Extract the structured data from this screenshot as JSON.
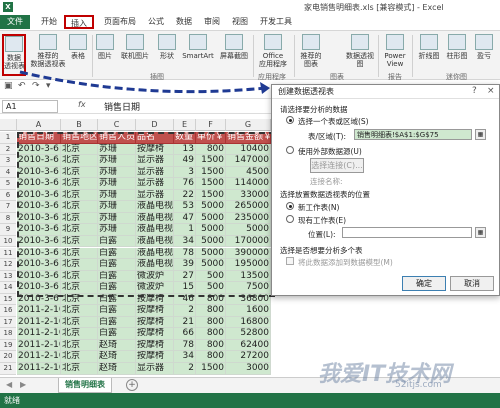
{
  "app": {
    "logo": "X",
    "title": "家电销售明细表.xls [兼容模式] - Excel"
  },
  "ribbon_tabs": [
    "文件",
    "开始",
    "插入",
    "页面布局",
    "公式",
    "数据",
    "审阅",
    "视图",
    "开发工具"
  ],
  "ribbon": {
    "pivot": "数据\n透视表",
    "recommended_pivot": "推荐的\n数据透视表",
    "table": "表格",
    "picture": "图片",
    "online_picture": "联机图片",
    "shapes": "形状",
    "smartart": "SmartArt",
    "screenshot": "屏幕截图",
    "office_apps": "Office\n应用程序",
    "recommended_charts": "推荐的\n图表",
    "pivot_chart": "数据透视图",
    "power_view": "Power\nView",
    "line": "折线图",
    "column": "柱形图",
    "win_loss": "盈亏",
    "groups": {
      "illustrations": "插图",
      "apps": "应用程序",
      "charts": "图表",
      "reports": "报告",
      "sparklines": "迷你图"
    }
  },
  "qa_icons": [
    "save-icon",
    "undo-icon",
    "redo-icon",
    "chevron-down-icon"
  ],
  "formula_bar": {
    "name_box": "A1",
    "fx": "fx",
    "value": "销售日期"
  },
  "columns": [
    "A",
    "B",
    "C",
    "D",
    "E",
    "F",
    "G"
  ],
  "table": {
    "headers": [
      "销售日期",
      "销售地区",
      "销售人员",
      "品名",
      "数量",
      "单价￥",
      "销售金额￥"
    ],
    "rows": [
      [
        "2010-3-6",
        "北京",
        "苏珊",
        "按摩椅",
        "13",
        "800",
        "10400"
      ],
      [
        "2010-3-6",
        "北京",
        "苏珊",
        "显示器",
        "49",
        "1500",
        "147000"
      ],
      [
        "2010-3-6",
        "北京",
        "苏珊",
        "显示器",
        "3",
        "1500",
        "4500"
      ],
      [
        "2010-3-6",
        "北京",
        "苏珊",
        "显示器",
        "76",
        "1500",
        "114000"
      ],
      [
        "2010-3-6",
        "北京",
        "苏珊",
        "显示器",
        "22",
        "1500",
        "33000"
      ],
      [
        "2010-3-6",
        "北京",
        "苏珊",
        "液晶电视",
        "53",
        "5000",
        "265000"
      ],
      [
        "2010-3-6",
        "北京",
        "苏珊",
        "液晶电视",
        "47",
        "5000",
        "235000"
      ],
      [
        "2010-3-6",
        "北京",
        "苏珊",
        "液晶电视",
        "1",
        "5000",
        "5000"
      ],
      [
        "2010-3-6",
        "北京",
        "白露",
        "液晶电视",
        "34",
        "5000",
        "170000"
      ],
      [
        "2010-3-6",
        "北京",
        "白露",
        "液晶电视",
        "78",
        "5000",
        "390000"
      ],
      [
        "2010-3-6",
        "北京",
        "白露",
        "液晶电视",
        "39",
        "5000",
        "195000"
      ],
      [
        "2010-3-6",
        "北京",
        "白露",
        "微波炉",
        "27",
        "500",
        "13500"
      ],
      [
        "2010-3-6",
        "北京",
        "白露",
        "微波炉",
        "15",
        "500",
        "7500"
      ],
      [
        "2010-3-6",
        "北京",
        "白露",
        "按摩椅",
        "46",
        "800",
        "36800"
      ],
      [
        "2011-2-10",
        "北京",
        "白露",
        "按摩椅",
        "2",
        "800",
        "1600"
      ],
      [
        "2011-2-10",
        "北京",
        "白露",
        "按摩椅",
        "21",
        "800",
        "16800"
      ],
      [
        "2011-2-10",
        "北京",
        "白露",
        "按摩椅",
        "66",
        "800",
        "52800"
      ],
      [
        "2011-2-10",
        "北京",
        "赵琦",
        "按摩椅",
        "78",
        "800",
        "62400"
      ],
      [
        "2011-2-10",
        "北京",
        "赵琦",
        "按摩椅",
        "34",
        "800",
        "27200"
      ],
      [
        "2011-2-10",
        "北京",
        "赵琦",
        "显示器",
        "2",
        "1500",
        "3000"
      ]
    ]
  },
  "row_numbers": [
    "1",
    "2",
    "3",
    "4",
    "5",
    "6",
    "7",
    "8",
    "9",
    "10",
    "11",
    "12",
    "13",
    "14",
    "15",
    "16",
    "17",
    "18",
    "19",
    "20",
    "21"
  ],
  "dialog": {
    "title": "创建数据透视表",
    "q_mark": "?",
    "close": "×",
    "section1": "请选择要分析的数据",
    "opt_select_table": "选择一个表或区域(S)",
    "range_label": "表/区域(T):",
    "range_value": "销售明细表!$A$1:$G$75",
    "opt_external": "使用外部数据源(U)",
    "choose_connection": "选择连接(C)...",
    "connection_name": "连接名称:",
    "section2": "选择放置数据透视表的位置",
    "opt_new_sheet": "新工作表(N)",
    "opt_existing": "现有工作表(E)",
    "location_label": "位置(L):",
    "location_value": "",
    "section3": "选择是否想要分析多个表",
    "add_to_model": "将此数据添加到数据模型(M)",
    "ok": "确定",
    "cancel": "取消"
  },
  "sheet": {
    "tab": "销售明细表",
    "add": "+",
    "nav_prev": "◀",
    "nav_next": "▶"
  },
  "status": "就绪",
  "watermark": {
    "main": "我爱IT技术网",
    "sub": "52itjs.com"
  }
}
